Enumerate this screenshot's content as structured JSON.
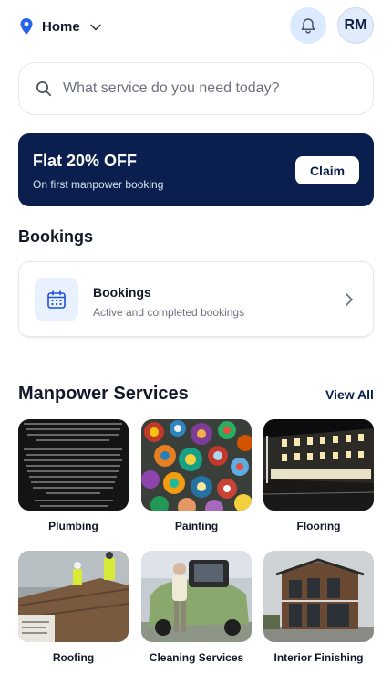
{
  "header": {
    "location_label": "Home",
    "avatar_initials": "RM"
  },
  "search": {
    "placeholder": "What service do you need today?"
  },
  "promo": {
    "title": "Flat 20% OFF",
    "subtitle": "On first manpower booking",
    "cta": "Claim"
  },
  "bookings_section": {
    "heading": "Bookings",
    "card_title": "Bookings",
    "card_subtitle": "Active and completed bookings"
  },
  "services_section": {
    "heading": "Manpower Services",
    "view_all": "View All",
    "items": [
      {
        "label": "Plumbing",
        "image": "text-quote-photo"
      },
      {
        "label": "Painting",
        "image": "glass-millefiori-photo"
      },
      {
        "label": "Flooring",
        "image": "building-at-night-photo"
      },
      {
        "label": "Roofing",
        "image": "roof-workers-photo"
      },
      {
        "label": "Cleaning Services",
        "image": "man-with-vintage-car-photo"
      },
      {
        "label": "Interior Finishing",
        "image": "modern-house-photo"
      }
    ]
  },
  "colors": {
    "brand_navy": "#0a1f4d",
    "accent_blue": "#2563eb",
    "soft_blue": "#dbeafe"
  }
}
